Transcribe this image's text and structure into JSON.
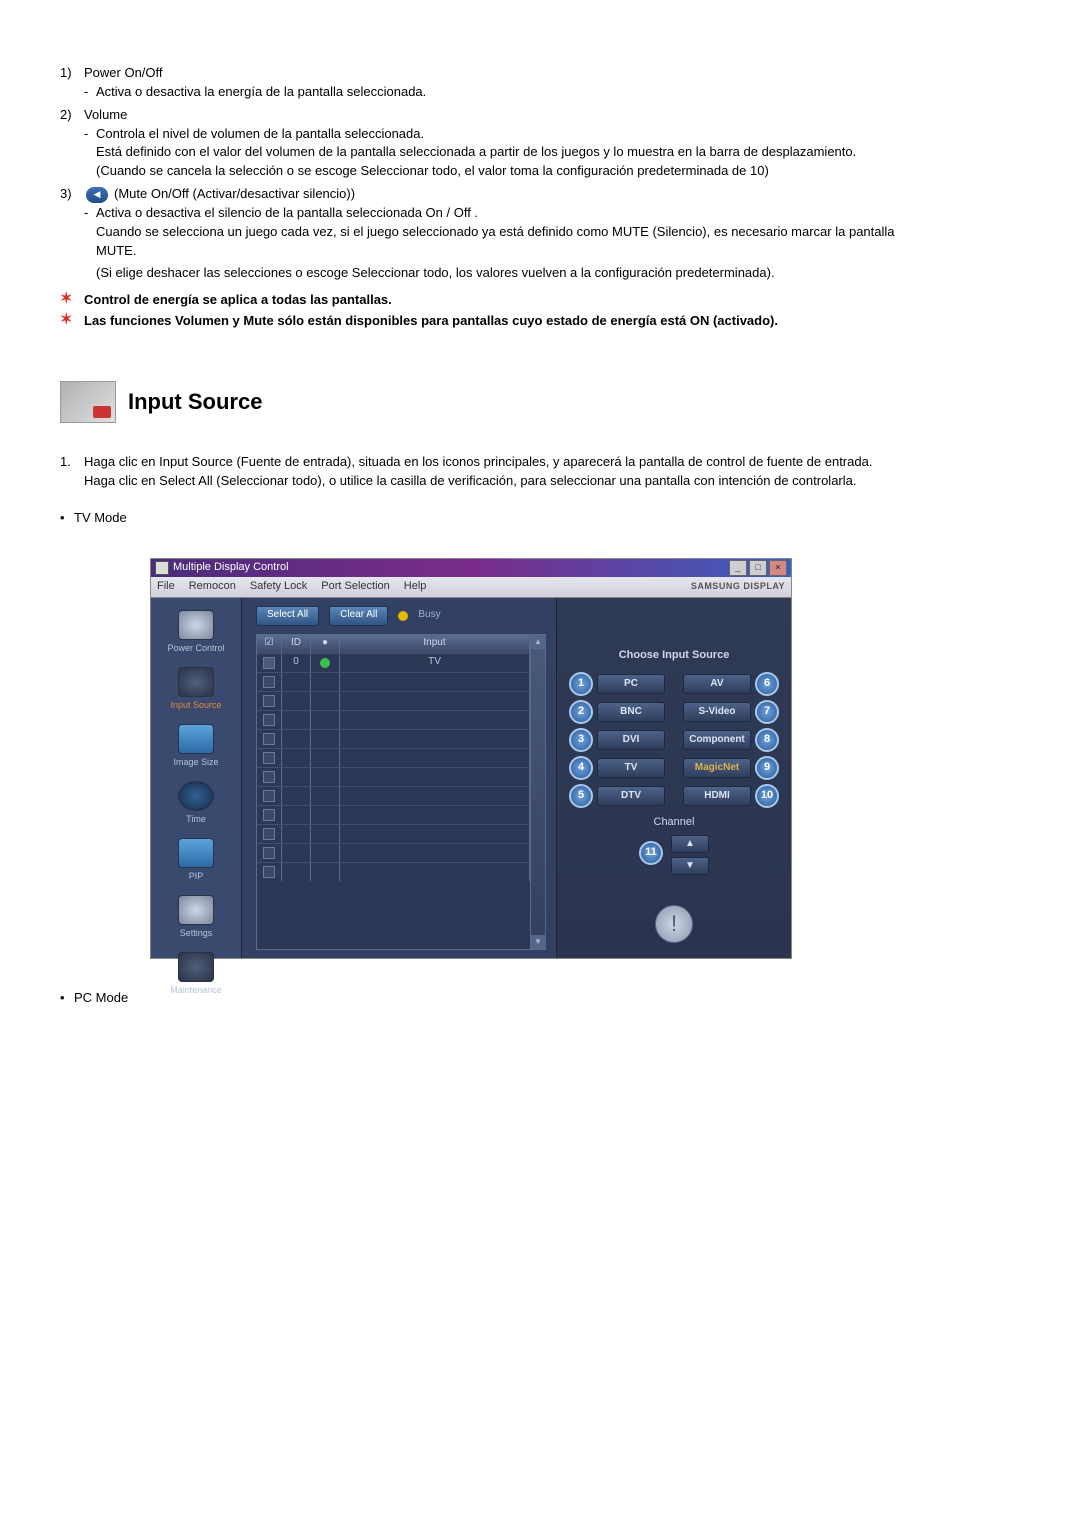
{
  "items": {
    "i1": {
      "num": "1)",
      "title": "Power On/Off",
      "dash": "-",
      "text": "Activa o desactiva la energía de la pantalla seleccionada."
    },
    "i2": {
      "num": "2)",
      "title": "Volume",
      "dash": "-",
      "l1": "Controla el nivel de volumen de la pantalla seleccionada.",
      "l2": "Está definido con el valor del volumen de la pantalla seleccionada a partir de los juegos y lo muestra en la barra de desplazamiento.",
      "l3": "(Cuando se cancela la selección o se escoge Seleccionar todo, el valor toma la configuración predeterminada de 10)"
    },
    "i3": {
      "num": "3)",
      "title": "(Mute On/Off (Activar/desactivar silencio))",
      "dash": "-",
      "l1": "Activa o desactiva el silencio de la pantalla seleccionada On / Off .",
      "l2": "Cuando se selecciona un juego cada vez, si el juego seleccionado ya está definido como MUTE (Silencio), es necesario marcar la pantalla MUTE.",
      "l3": "(Si elige deshacer las selecciones o escoge Seleccionar todo, los valores vuelven a la configuración predeterminada)."
    }
  },
  "stars": {
    "s1": "Control de energía se aplica a todas las pantallas.",
    "s2": "Las funciones Volumen y Mute sólo están disponibles para pantallas cuyo estado de energía está ON (activado)."
  },
  "section": {
    "title": "Input Source"
  },
  "intro": {
    "num": "1.",
    "l1": "Haga clic en Input Source (Fuente de entrada), situada en los iconos principales, y aparecerá la pantalla de control de fuente de entrada.",
    "l2": "Haga clic en Select All (Seleccionar todo), o utilice la casilla de verificación, para seleccionar una pantalla con intención de controlarla.",
    "tv": "TV Mode",
    "pc": "PC Mode",
    "bullet": "•"
  },
  "shot": {
    "title": "Multiple Display Control",
    "menu": {
      "file": "File",
      "remocon": "Remocon",
      "safety": "Safety Lock",
      "port": "Port Selection",
      "help": "Help"
    },
    "brand": "SAMSUNG DISPLAY",
    "btn": {
      "select": "Select All",
      "clear": "Clear All",
      "busy": "Busy"
    },
    "col": {
      "chk": "☑",
      "id": "ID",
      "st": "●",
      "input": "Input"
    },
    "row0": {
      "id": "0",
      "input": "TV"
    },
    "side": {
      "power": "Power Control",
      "input": "Input Source",
      "image": "Image Size",
      "time": "Time",
      "pip": "PIP",
      "settings": "Settings",
      "maint": "Maintenance"
    },
    "right": {
      "title": "Choose Input Source",
      "src": {
        "pc": "PC",
        "bnc": "BNC",
        "dvi": "DVI",
        "tv": "TV",
        "dtv": "DTV",
        "av": "AV",
        "svideo": "S-Video",
        "component": "Component",
        "magicnet": "MagicNet",
        "hdmi": "HDMI"
      },
      "num": {
        "n1": "1",
        "n2": "2",
        "n3": "3",
        "n4": "4",
        "n5": "5",
        "n6": "6",
        "n7": "7",
        "n8": "8",
        "n9": "9",
        "n10": "10",
        "n11": "11"
      },
      "channel": "Channel",
      "up": "▲",
      "down": "▼"
    },
    "winbtn": {
      "min": "_",
      "max": "□",
      "close": "×"
    },
    "scroll": {
      "up": "▲",
      "down": "▼"
    }
  }
}
